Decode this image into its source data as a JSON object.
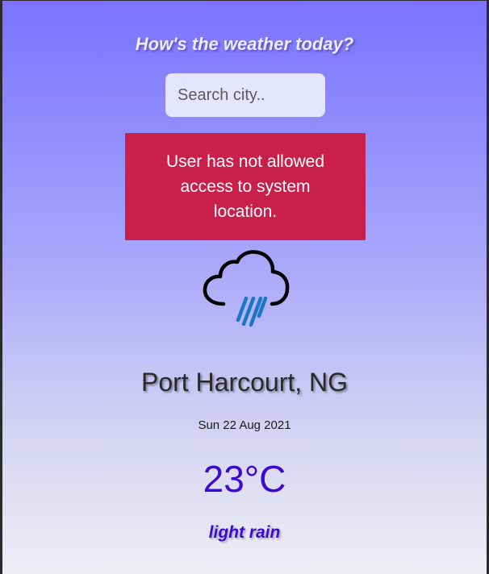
{
  "header": {
    "title": "How's the weather today?"
  },
  "search": {
    "placeholder": "Search city..",
    "value": ""
  },
  "alert": {
    "message": "User has not allowed access to system location.",
    "color": "#c91f4b"
  },
  "weather": {
    "icon": "cloud-rain-icon",
    "location": "Port Harcourt, NG",
    "date": "Sun 22 Aug 2021",
    "temperature": "23°C",
    "description": "light rain",
    "accent_color": "#3a0ad2"
  }
}
